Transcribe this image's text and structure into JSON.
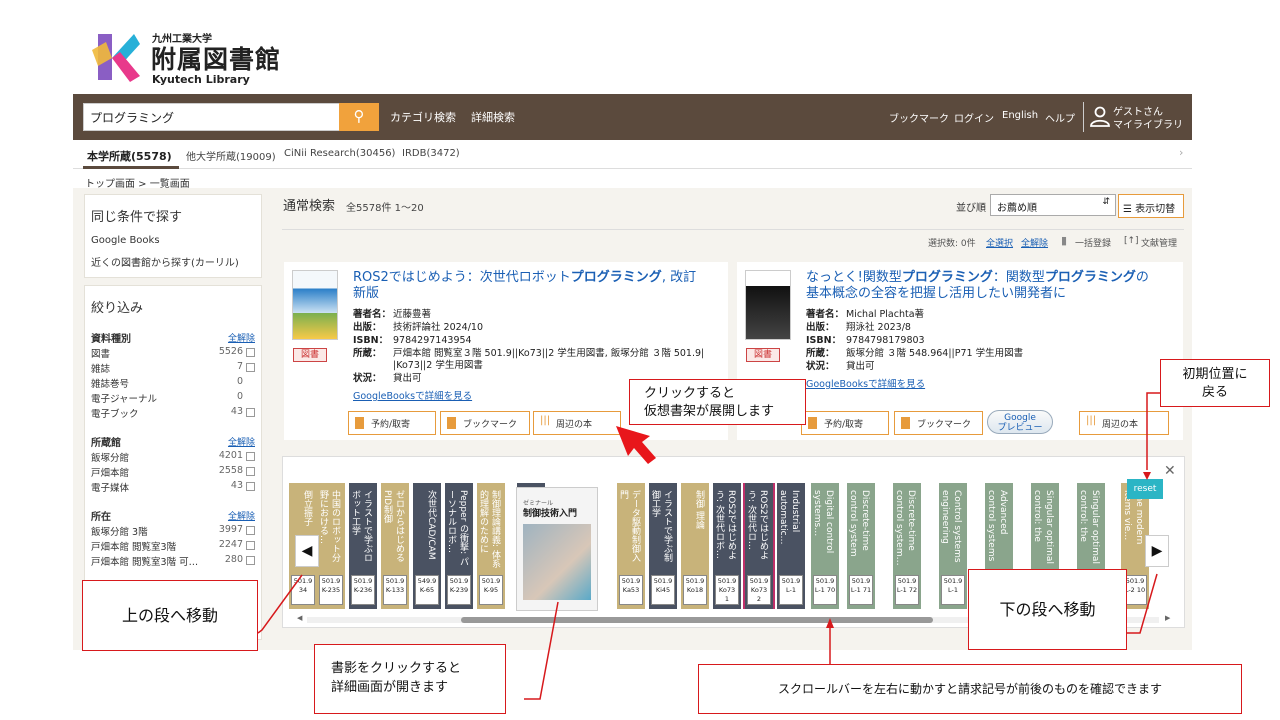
{
  "logo": {
    "university": "九州工業大学",
    "name": "附属図書館",
    "english": "Kyutech Library"
  },
  "header": {
    "search_value": "プログラミング",
    "category_search": "カテゴリ検索",
    "advanced_search": "詳細検索",
    "bookmark": "ブックマーク",
    "login": "ログイン",
    "english": "English",
    "help": "ヘルプ",
    "user_line1": "ゲストさん",
    "user_line2": "マイライブラリ"
  },
  "tabs": [
    {
      "label": "本学所蔵(5578)"
    },
    {
      "label": "他大学所蔵(19009)"
    },
    {
      "label": "CiNii Research(30456)"
    },
    {
      "label": "IRDB(3472)"
    }
  ],
  "breadcrumb": "トップ画面 > 一覧画面",
  "same_conditions": {
    "title": "同じ条件で探す",
    "links": [
      "Google Books",
      "近くの図書館から探す(カーリル)"
    ]
  },
  "filter": {
    "title": "絞り込み",
    "clear_label": "全解除",
    "groups": [
      {
        "heading": "資料種別",
        "items": [
          {
            "label": "図書",
            "count": "5526"
          },
          {
            "label": "雑誌",
            "count": "7"
          },
          {
            "label": "雑誌巻号",
            "count": "0"
          },
          {
            "label": "電子ジャーナル",
            "count": "0"
          },
          {
            "label": "電子ブック",
            "count": "43"
          }
        ]
      },
      {
        "heading": "所蔵館",
        "items": [
          {
            "label": "飯塚分館",
            "count": "4201"
          },
          {
            "label": "戸畑本館",
            "count": "2558"
          },
          {
            "label": "電子媒体",
            "count": "43"
          }
        ]
      },
      {
        "heading": "所在",
        "items": [
          {
            "label": "飯塚分館 3階",
            "count": "3997"
          },
          {
            "label": "戸畑本館 閲覧室3階",
            "count": "2247"
          },
          {
            "label": "戸畑本館 閲覧室3階 可…",
            "count": "280"
          }
        ]
      }
    ]
  },
  "main": {
    "title": "通常検索",
    "count": "全5578件 1〜20",
    "sort_label": "並び順",
    "sort_value": "お薦め順",
    "view_toggle": "表示切替",
    "selected_count": "選択数: 0件",
    "select_all": "全選択",
    "clear_all": "全解除",
    "bulk_register": "一括登録",
    "doc_manage": "文献管理"
  },
  "books": [
    {
      "title_pre": "ROS2ではじめよう：次世代ロボット",
      "title_hl": "プログラミング",
      "title_post": ", 改訂新版",
      "author_k": "著者名：",
      "author": "近藤豊著",
      "pub_k": "出版：",
      "pub": "技術評論社 2024/10",
      "isbn_k": "ISBN：",
      "isbn": "9784297143954",
      "holding_k": "所蔵：",
      "holding1": "戸畑本館 閲覧室３階 501.9||Ko73||2 学生用図書, 飯塚分館 ３階 501.9|",
      "holding2": "|Ko73||2 学生用図書",
      "status_k": "状況：",
      "status": "貸出可",
      "badge": "図書",
      "google_link": "GoogleBooksで詳細を見る",
      "btn_reserve": "予約/取寄",
      "btn_bookmark": "ブックマーク",
      "btn_nearby": "周辺の本"
    },
    {
      "title_pre": "なっとく!関数型",
      "title_hl": "プログラミング",
      "title_mid": "：関数型",
      "title_hl2": "プログラミング",
      "title_post": "の基本概念の全容を把握し活用したい開発者に",
      "author_k": "著者名：",
      "author": "Michal Plachta著",
      "pub_k": "出版：",
      "pub": "翔泳社 2023/8",
      "isbn_k": "ISBN：",
      "isbn": "9784798179803",
      "holding_k": "所蔵：",
      "holding1": "飯塚分館 ３階 548.964||P71 学生用図書",
      "status_k": "状況：",
      "status": "貸出可",
      "badge": "図書",
      "google_link": "GoogleBooksで詳細を見る",
      "google_preview1": "Google",
      "google_preview2": "プレビュー",
      "btn_reserve": "予約/取寄",
      "btn_bookmark": "ブックマーク",
      "btn_nearby": "周辺の本"
    }
  ],
  "shelf": {
    "reset": "reset",
    "cover_title_small": "ゼミナール",
    "cover_title": "制御技術入門",
    "spines": [
      {
        "title": "倒立振子",
        "call": "501.9 34",
        "color": "#c8b37a"
      },
      {
        "title": "中国のロボット分野における…",
        "call": "501.9 K-235",
        "color": "#c8b37a"
      },
      {
        "title": "イラストで学ぶロボット工学",
        "call": "501.9 K-236",
        "color": "#4a5262"
      },
      {
        "title": "ゼロからはじめるPID制御",
        "call": "501.9 K-133",
        "color": "#c8b37a"
      },
      {
        "title": "次世代CAD/CAM",
        "call": "549.9 K-65",
        "color": "#4a5262"
      },
      {
        "title": "Pepper の衝撃: パーソナルロボ…",
        "call": "501.9 K-239",
        "color": "#4a5262"
      },
      {
        "title": "制御理論講義: 体系的理解のために",
        "call": "501.9 K-95",
        "color": "#c8b37a"
      },
      {
        "title": "ヒューマノイドロボット",
        "call": "501.9 Ka23 2",
        "color": "#4a5262"
      },
      {
        "title": "データ駆動制御入門",
        "call": "501.9 Ka53",
        "color": "#c8b37a"
      },
      {
        "title": "イラストで学ぶ制御工学",
        "call": "501.9 Ki45",
        "color": "#4a5262"
      },
      {
        "title": "制御 理論",
        "call": "501.9 Ko18",
        "color": "#c8b37a"
      },
      {
        "title": "ROS2ではじめよう: 次世代ロボ…",
        "call": "501.9 Ko73 1",
        "color": "#4a5262"
      },
      {
        "title": "ROS2ではじめよう: 次世代ロ…",
        "call": "501.9 Ko73 2",
        "color": "#4a5262"
      },
      {
        "title": "Industrial automatic…",
        "call": "501.9 L-1",
        "color": "#4a5262"
      },
      {
        "title": "Digital control systems…",
        "call": "501.9 L-1 70",
        "color": "#8aa58c"
      },
      {
        "title": "Discrete-time control system analysis an…",
        "call": "501.9 L-1 71",
        "color": "#8aa58c"
      },
      {
        "title": "Discrete-time control system…",
        "call": "501.9 L-1 72",
        "color": "#8aa58c"
      },
      {
        "title": "Control systems engineering",
        "call": "501.9 L-1",
        "color": "#8aa58c"
      },
      {
        "title": "Advanced control systems engineering",
        "call": "501.9 L-1",
        "color": "#8aa58c"
      },
      {
        "title": "Singular optimal control: the linear…",
        "call": "501.9 L-1",
        "color": "#8aa58c"
      },
      {
        "title": "Singular optimal control: the linear…",
        "call": "501.9 L-2 6",
        "color": "#8aa58c"
      },
      {
        "title": "The modern items vie…",
        "call": "501.9 L-2 10",
        "color": "#c8b37a"
      }
    ]
  },
  "callouts": {
    "shelf_open": [
      "クリックすると",
      "仮想書架が展開します"
    ],
    "reset_pos": [
      "初期位置に",
      "戻る"
    ],
    "move_up": "上の段へ移動",
    "move_down": "下の段へ移動",
    "cover_click": [
      "書影をクリックすると",
      "詳細画面が開きます"
    ],
    "scroll_info": "スクロールバーを左右に動かすと請求記号が前後のものを確認できます"
  },
  "colors": {
    "header_bg": "#5b4a3d",
    "accent": "#e79b3c",
    "link": "#1a5fb4",
    "callout_border": "#d7191c",
    "reset": "#2bb5c5"
  }
}
